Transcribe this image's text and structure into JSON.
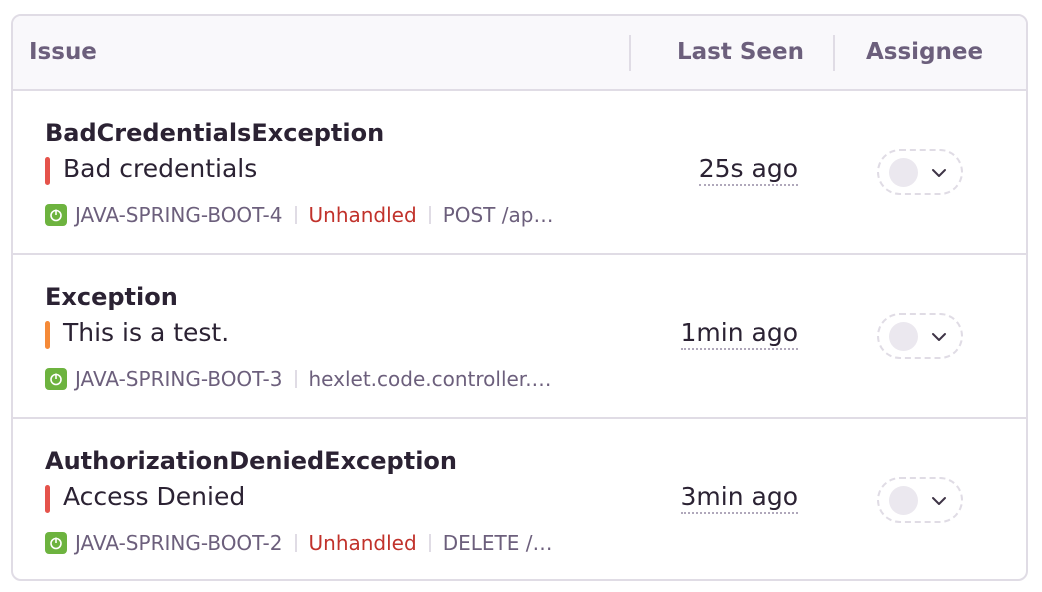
{
  "header": {
    "issue_label": "Issue",
    "last_seen_label": "Last Seen",
    "assignee_label": "Assignee"
  },
  "colors": {
    "error_bar": "#e5534b",
    "warning_bar": "#f58a38",
    "unhandled": "#c1322b",
    "project_icon": "#6db33f"
  },
  "issues": [
    {
      "title": "BadCredentialsException",
      "message": "Bad credentials",
      "level_color": "#e5534b",
      "project": "JAVA-SPRING-BOOT-4",
      "status": "Unhandled",
      "detail": "POST /ap…",
      "last_seen": "25s ago",
      "icon": "spring-boot-icon"
    },
    {
      "title": "Exception",
      "message": "This is a test.",
      "level_color": "#f58a38",
      "project": "JAVA-SPRING-BOOT-3",
      "status": "",
      "detail": "hexlet.code.controller.…",
      "last_seen": "1min ago",
      "icon": "spring-boot-icon"
    },
    {
      "title": "AuthorizationDeniedException",
      "message": "Access Denied",
      "level_color": "#e5534b",
      "project": "JAVA-SPRING-BOOT-2",
      "status": "Unhandled",
      "detail": "DELETE /…",
      "last_seen": "3min ago",
      "icon": "spring-boot-icon"
    }
  ]
}
